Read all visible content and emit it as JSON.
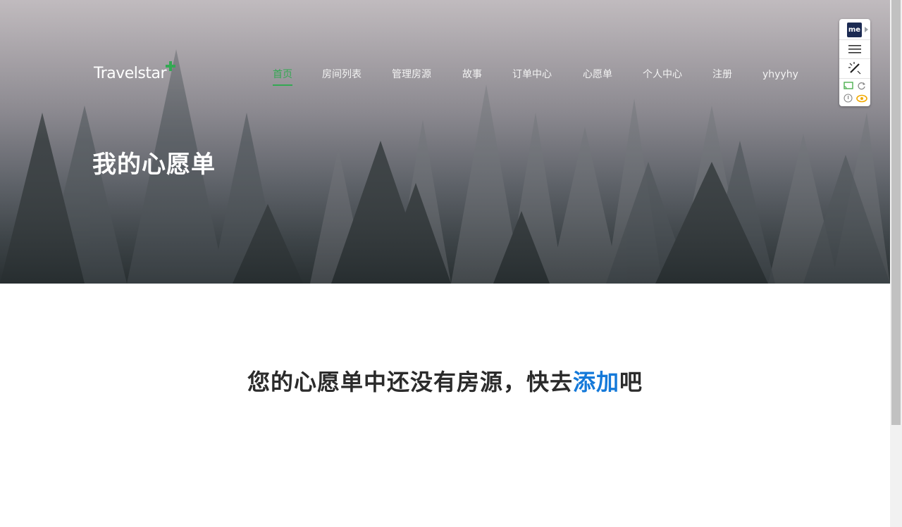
{
  "header": {
    "logo_text": "Travelstar",
    "nav": [
      {
        "label": "首页",
        "active": true
      },
      {
        "label": "房间列表",
        "active": false
      },
      {
        "label": "管理房源",
        "active": false
      },
      {
        "label": "故事",
        "active": false
      },
      {
        "label": "订单中心",
        "active": false
      },
      {
        "label": "心愿单",
        "active": false
      },
      {
        "label": "个人中心",
        "active": false
      },
      {
        "label": "注册",
        "active": false
      },
      {
        "label": "yhyyhy",
        "active": false
      }
    ]
  },
  "hero": {
    "title": "我的心愿单"
  },
  "main": {
    "empty_prefix": "您的心愿单中还没有房源，快去",
    "empty_link": "添加",
    "empty_suffix": "吧"
  },
  "extension": {
    "badge": "me",
    "icons": [
      "menu-icon",
      "magic-wand-icon",
      "cast-icon",
      "refresh-icon",
      "info-icon",
      "eye-icon"
    ]
  },
  "colors": {
    "accent_green": "#34a853",
    "link_blue": "#1479d9",
    "badge_navy": "#1b2a52"
  }
}
